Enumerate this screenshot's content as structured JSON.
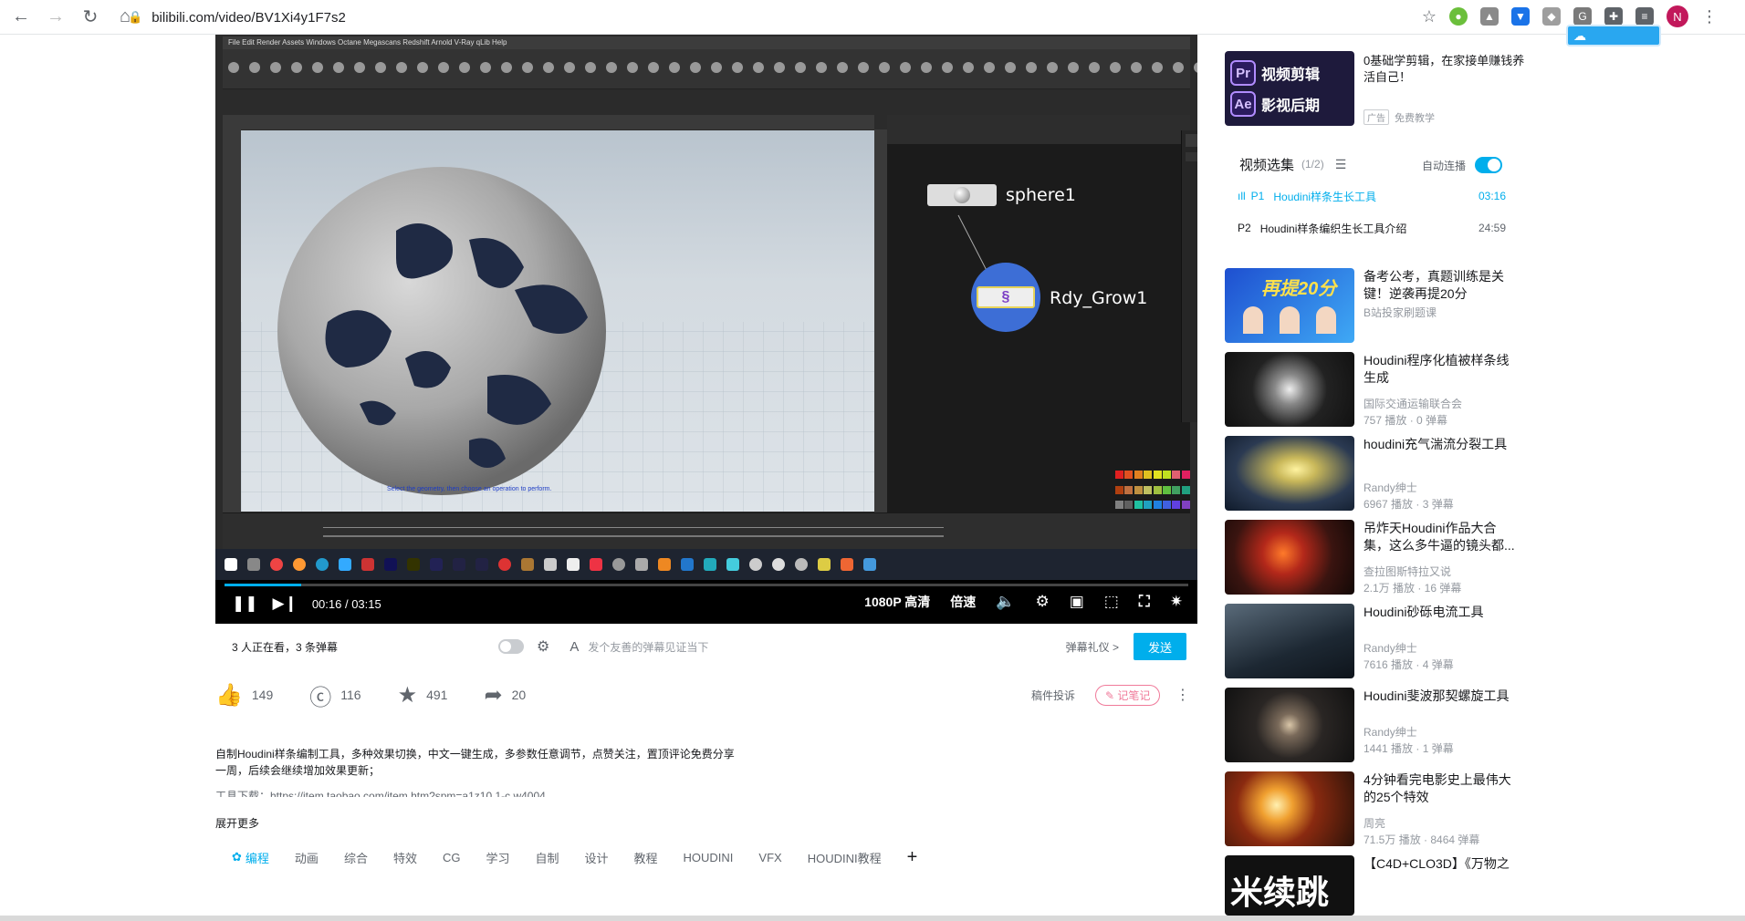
{
  "browser": {
    "url": "bilibili.com/video/BV1Xi4y1F7s2",
    "avatar_letter": "N"
  },
  "player": {
    "time": "00:16 / 03:15",
    "quality": "1080P 高清",
    "speed": "倍速",
    "progress_fraction": 0.08,
    "nodes": {
      "node1": "sphere1",
      "node2": "Rdy_Grow1"
    },
    "viewport_hint": "Select the geometry, then choose an operation to perform."
  },
  "danmaku": {
    "watching": "3 人正在看，3 条弹幕",
    "placeholder": "发个友善的弹幕见证当下",
    "etiquette": "弹幕礼仪 >",
    "send": "发送"
  },
  "actions": {
    "like": "149",
    "coin": "116",
    "favorite": "491",
    "share": "20",
    "report": "稿件投诉",
    "notes": "记笔记"
  },
  "description": {
    "line1": "自制Houdini样条编制工具，多种效果切换，中文一键生成，多参数任意调节，点赞关注，置顶评论免费分享",
    "line2": "一周，后续会继续增加效果更新；",
    "line3": "工具下载：https://item.taobao.com/item.htm?spm=a1z10.1-c.w4004",
    "more": "展开更多"
  },
  "tags": [
    "编程",
    "动画",
    "综合",
    "特效",
    "CG",
    "学习",
    "自制",
    "设计",
    "教程",
    "HOUDINI",
    "VFX",
    "HOUDINI教程"
  ],
  "ad": {
    "badge1": "Pr",
    "badge1_text": "视频剪辑",
    "badge2": "Ae",
    "badge2_text": "影视后期",
    "title": "0基础学剪辑，在家接单赚钱养活自己！",
    "label": "广告",
    "source": "免费教学"
  },
  "playlist": {
    "title": "视频选集",
    "count": "(1/2)",
    "autoplay": "自动连播",
    "items": [
      {
        "idx": "P1",
        "title": "Houdini样条生长工具",
        "duration": "03:16"
      },
      {
        "idx": "P2",
        "title": "Houdini样条编织生长工具介绍",
        "duration": "24:59"
      }
    ]
  },
  "recommendations": [
    {
      "title": "备考公考，真题训练是关键！逆袭再提20分",
      "up": "B站投家刷题课",
      "stats": "",
      "thumb_text": "再提20分"
    },
    {
      "title": "Houdini程序化植被样条线生成",
      "up": "国际交通运输联合会",
      "stats": "757 播放 · 0 弹幕"
    },
    {
      "title": "houdini充气湍流分裂工具",
      "up": "Randy绅士",
      "stats": "6967 播放 · 3 弹幕"
    },
    {
      "title": "吊炸天Houdini作品大合集，这么多牛逼的镜头都...",
      "up": "查拉图斯特拉又说",
      "stats": "2.1万 播放 · 16 弹幕"
    },
    {
      "title": "Houdini砂砾电流工具",
      "up": "Randy绅士",
      "stats": "7616 播放 · 4 弹幕"
    },
    {
      "title": "Houdini斐波那契螺旋工具",
      "up": "Randy绅士",
      "stats": "1441 播放 · 1 弹幕"
    },
    {
      "title": "4分钟看完电影史上最伟大的25个特效",
      "up": "周亮",
      "stats": "71.5万 播放 · 8464 弹幕"
    },
    {
      "title": "【C4D+CLO3D】《万物之",
      "up": "",
      "stats": "",
      "thumb_text": "米续跳"
    }
  ]
}
